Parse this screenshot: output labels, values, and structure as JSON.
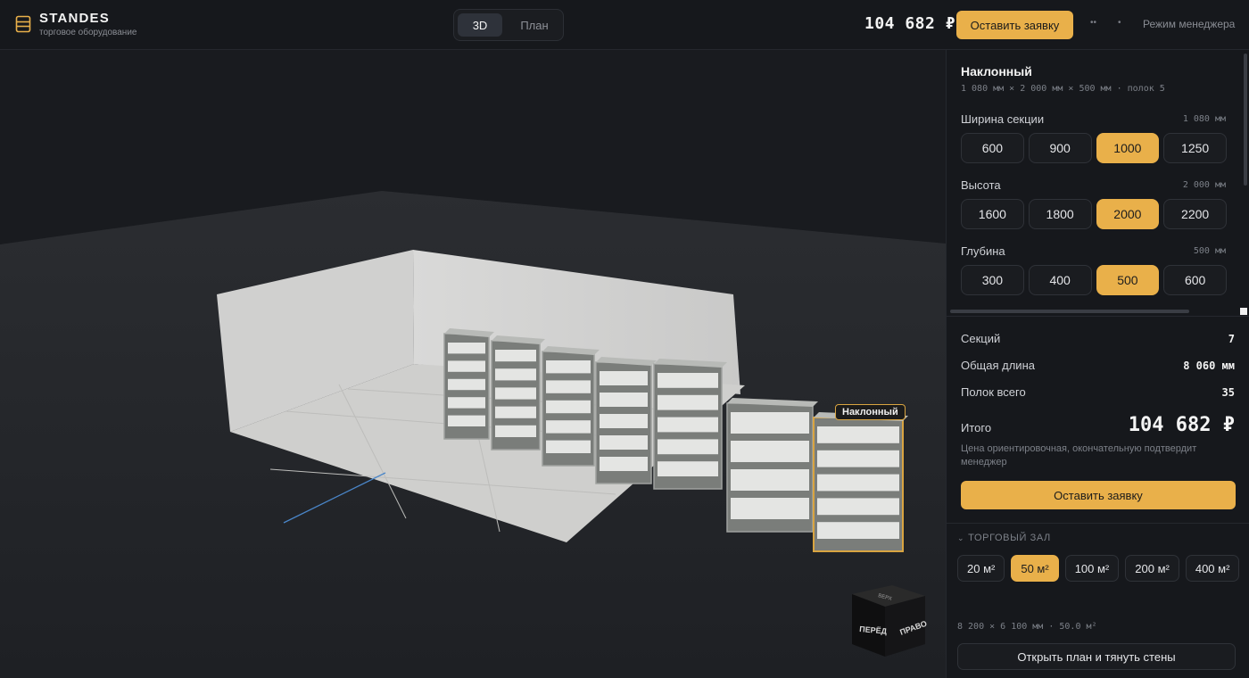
{
  "header": {
    "brand": "STANDES",
    "brand_sub": "торговое оборудование",
    "views": [
      {
        "label": "3D",
        "active": true
      },
      {
        "label": "План",
        "active": false
      }
    ],
    "price": "104 682 ₽",
    "order_label": "Оставить заявку",
    "dot1": "••",
    "dot2": "•",
    "manager_label": "Режим менеджера"
  },
  "viewport": {
    "selected_tag": "Наклонный",
    "cube": {
      "front": "ПЕРЁД",
      "right": "ПРАВО",
      "top": "ВЕРХ"
    }
  },
  "product": {
    "title": "Наклонный",
    "subtitle": "1 080 мм × 2 000 мм × 500 мм · полок 5"
  },
  "options": [
    {
      "label": "Ширина секции",
      "value": "1 080 мм",
      "choices": [
        "600",
        "900",
        "1000",
        "1250"
      ],
      "selected": 2
    },
    {
      "label": "Высота",
      "value": "2 000 мм",
      "choices": [
        "1600",
        "1800",
        "2000",
        "2200"
      ],
      "selected": 2
    },
    {
      "label": "Глубина",
      "value": "500 мм",
      "choices": [
        "300",
        "400",
        "500",
        "600"
      ],
      "selected": 2
    }
  ],
  "summary": {
    "sections_label": "Секций",
    "sections_value": "7",
    "length_label": "Общая длина",
    "length_value": "8 060 мм",
    "shelves_label": "Полок всего",
    "shelves_value": "35",
    "total_label": "Итого",
    "total_value": "104 682 ₽",
    "disclaimer": "Цена ориентировочная, окончательную подтвердит менеджер",
    "order_label": "Оставить заявку"
  },
  "hall": {
    "heading": "ТОРГОВЫЙ ЗАЛ",
    "areas": [
      {
        "label": "20 м²",
        "active": false
      },
      {
        "label": "50 м²",
        "active": true
      },
      {
        "label": "100 м²",
        "active": false
      },
      {
        "label": "200 м²",
        "active": false
      },
      {
        "label": "400 м²",
        "active": false
      }
    ],
    "dims": "8 200 × 6 100 мм · 50.0 м²",
    "plan_label": "Открыть план и тянуть стены"
  },
  "colors": {
    "accent": "#e9b04a",
    "background": "#16181c"
  }
}
